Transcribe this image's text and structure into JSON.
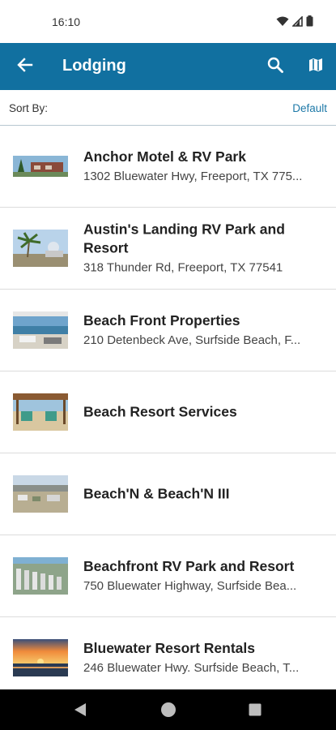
{
  "status_bar": {
    "time": "16:10",
    "icons": [
      "wifi-icon",
      "signal-icon",
      "battery-icon"
    ]
  },
  "app_bar": {
    "title": "Lodging",
    "background": "#1170a0",
    "icons": [
      "back-arrow-icon",
      "search-icon",
      "map-icon"
    ]
  },
  "sort": {
    "label": "Sort By:",
    "value": "Default"
  },
  "listings": [
    {
      "name": "Anchor Motel & RV Park",
      "address": "1302 Bluewater Hwy, Freeport, TX 775..."
    },
    {
      "name": "Austin's Landing RV Park and Resort",
      "address": "318 Thunder Rd, Freeport, TX 77541"
    },
    {
      "name": "Beach Front Properties",
      "address": "210 Detenbeck Ave, Surfside Beach, F..."
    },
    {
      "name": "Beach Resort Services",
      "address": ""
    },
    {
      "name": "Beach'N & Beach'N III",
      "address": ""
    },
    {
      "name": "Beachfront RV Park and Resort",
      "address": "750 Bluewater Highway, Surfside Bea..."
    },
    {
      "name": "Bluewater Resort Rentals",
      "address": "246 Bluewater Hwy. Surfside Beach, T..."
    }
  ],
  "nav_bar": {
    "icons": [
      "nav-back-icon",
      "nav-home-icon",
      "nav-recents-icon"
    ]
  }
}
